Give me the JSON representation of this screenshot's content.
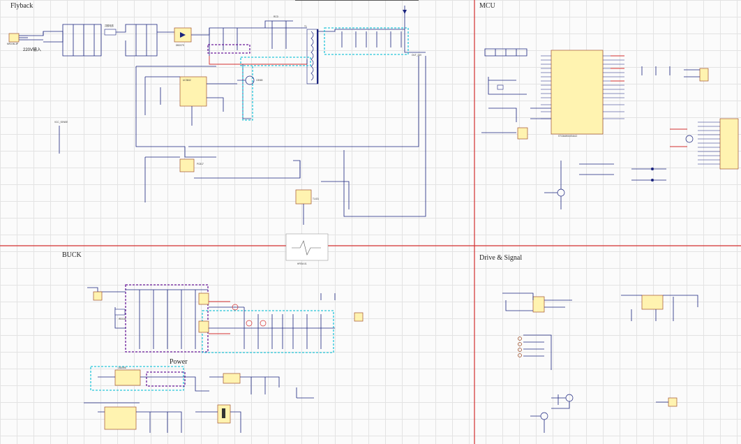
{
  "sections": {
    "flyback": "Flyback",
    "mcu": "MCU",
    "buck": "BUCK",
    "drive_signal": "Drive & Signal",
    "power": "Power"
  },
  "labels": {
    "ac_input": "220V输入",
    "mcu_chip": "STC8A8K64S4A12",
    "flyback_controller": "UC3842",
    "buck_driver": "IR2104",
    "power_reg": "LM2596",
    "transformer": "T1",
    "optocoupler": "PC817",
    "tl431": "TL431"
  },
  "colors": {
    "grid": "#e3e3e3",
    "divider": "#d32f2f",
    "wire": "#1a237e",
    "ic_fill": "#fff3b0",
    "buck_box": "#6a1b9a",
    "highlight_box": "#26c6da"
  }
}
